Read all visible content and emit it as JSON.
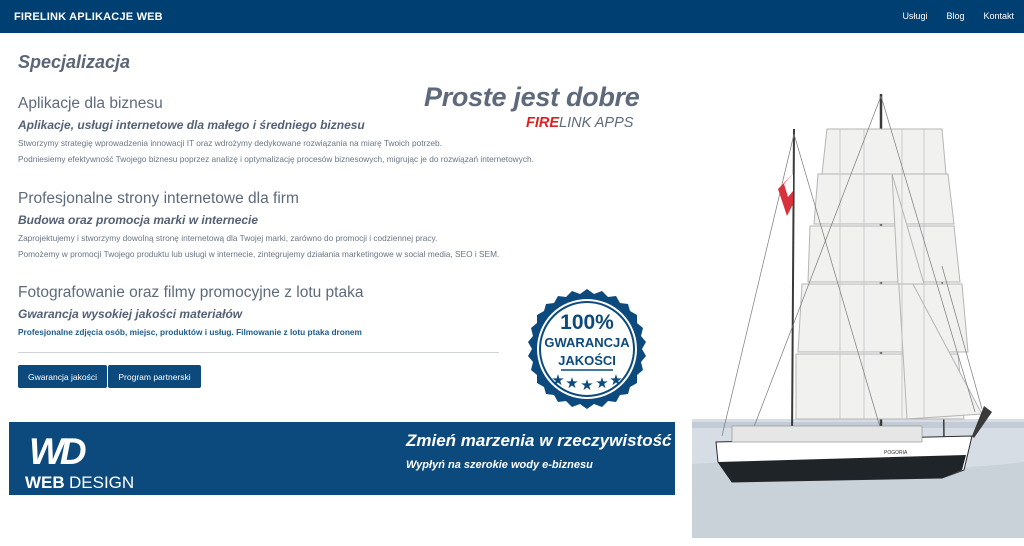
{
  "header": {
    "brand": "FIRELINK APLIKACJE WEB",
    "nav": [
      "Usługi",
      "Blog",
      "Kontakt"
    ]
  },
  "page": {
    "title": "Specjalizacja"
  },
  "sections": [
    {
      "title": "Aplikacje dla biznesu",
      "subtitle": "Aplikacje, usługi internetowe dla małego i średniego biznesu",
      "lines": [
        "Stworzymy strategię wprowadzenia innowacji IT oraz wdrożymy dedykowane rozwiązania na miarę Twoich potrzeb.",
        "Podniesiemy efektywność Twojego biznesu poprzez analizę i optymalizację procesów biznesowych, migrując je do rozwiązań internetowych."
      ]
    },
    {
      "title": "Profesjonalne strony internetowe dla firm",
      "subtitle": "Budowa oraz promocja marki w internecie",
      "lines": [
        "Zaprojektujemy i stworzymy dowolną stronę internetową dla Twojej marki, zarówno do promocji i codziennej pracy.",
        "Pomożemy w promocji Twojego produktu lub usługi w internecie, zintegrujemy działania marketingowe w social media, SEO i SEM."
      ]
    },
    {
      "title": "Fotografowanie oraz filmy promocyjne z lotu ptaka",
      "subtitle": "Gwarancja wysokiej jakości materiałów",
      "lines": [
        "Profesjonalne zdjęcia osób, miejsc, produktów i usług. Filmowanie z lotu ptaka dronem"
      ]
    }
  ],
  "slogan": {
    "main": "Proste jest dobre",
    "brand_red": "FIRE",
    "brand_rest": "LINK APPS"
  },
  "badge": {
    "percent": "100%",
    "line1": "GWARANCJA",
    "line2": "JAKOŚCI"
  },
  "buttons": {
    "quality": "Gwarancja jakości",
    "partner": "Program partnerski"
  },
  "banner": {
    "logo_mark": "WD",
    "logo_web": "WEB",
    "logo_design": "DESIGN",
    "title": "Zmień marzenia w rzeczywistość",
    "subtitle": "Wypłyń na szerokie wody e-biznesu"
  },
  "photo": {
    "ship_hull_text": "POGORIA"
  },
  "colors": {
    "navy": "#003f72",
    "button": "#0c4a7e",
    "text_gray": "#5e6a7b",
    "accent_red": "#e02020"
  }
}
